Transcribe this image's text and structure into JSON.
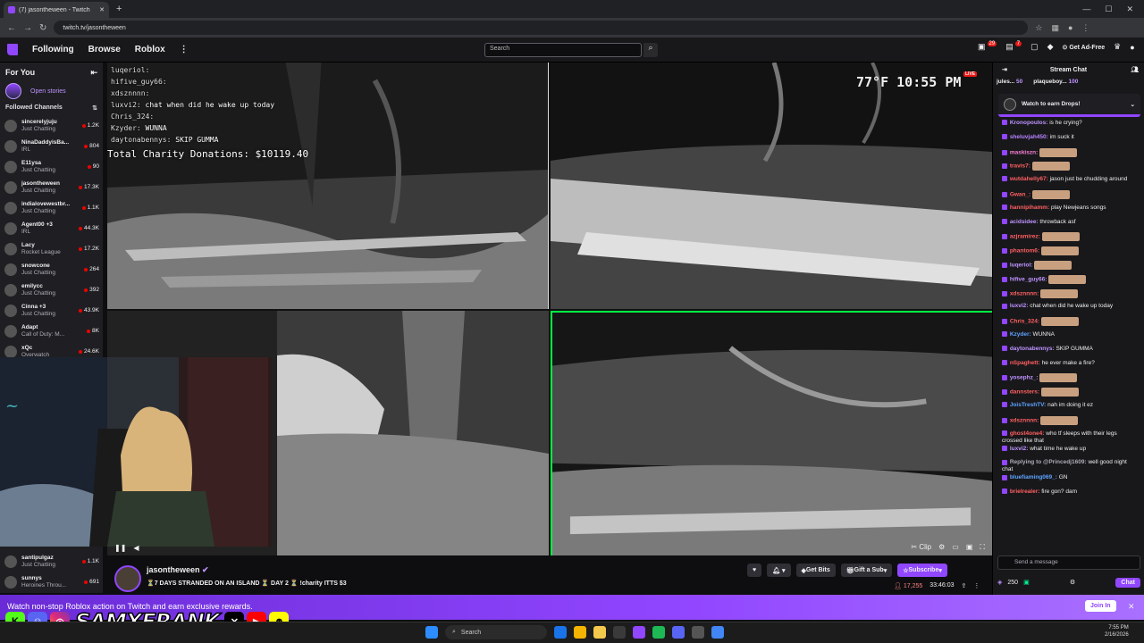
{
  "browser": {
    "tab_title": "(7) jasontheween - Twitch",
    "new_tab": "+",
    "url": "twitch.tv/jasontheween"
  },
  "topnav": {
    "following": "Following",
    "browse": "Browse",
    "roblox": "Roblox",
    "more": "⋮",
    "search_placeholder": "Search",
    "notif_count_1": "29",
    "notif_count_2": "7",
    "get_ad_free": "Get Ad-Free"
  },
  "sidebar": {
    "for_you": "For You",
    "open_stories": "Open stories",
    "followed_channels": "Followed Channels",
    "channels": [
      {
        "name": "sincerelyjuju",
        "game": "Just Chatting",
        "viewers": "1.2K"
      },
      {
        "name": "NinaDaddyisBa...",
        "game": "IRL",
        "viewers": "804"
      },
      {
        "name": "E11ysa",
        "game": "Just Chatting",
        "viewers": "90"
      },
      {
        "name": "jasontheween",
        "game": "Just Chatting",
        "viewers": "17.3K"
      },
      {
        "name": "indialovewestbr...",
        "game": "Just Chatting",
        "viewers": "1.1K"
      },
      {
        "name": "Agent00 +3",
        "game": "IRL",
        "viewers": "44.3K"
      },
      {
        "name": "Lacy",
        "game": "Rocket League",
        "viewers": "17.2K"
      },
      {
        "name": "snowcone",
        "game": "Just Chatting",
        "viewers": "264"
      },
      {
        "name": "emilycc",
        "game": "Just Chatting",
        "viewers": "392"
      },
      {
        "name": "Cinna +3",
        "game": "Just Chatting",
        "viewers": "43.9K"
      },
      {
        "name": "Adapt",
        "game": "Call of Duty: M...",
        "viewers": "8K"
      },
      {
        "name": "xQc",
        "game": "Overwatch",
        "viewers": "24.6K"
      }
    ],
    "lower_channels": [
      {
        "name": "santipulgaz",
        "game": "Just Chatting",
        "viewers": "1.1K"
      },
      {
        "name": "sunnys",
        "game": "Heroines Throu...",
        "viewers": "691"
      }
    ]
  },
  "video": {
    "overlay_chat": [
      {
        "user": "luqeriol:",
        "text": ""
      },
      {
        "user": "hifive_guy66:",
        "text": ""
      },
      {
        "user": "xdsznnnn:",
        "text": ""
      },
      {
        "user": "luxvi2:",
        "text": "chat when did he wake up today"
      },
      {
        "user": "Chris_324:",
        "text": ""
      },
      {
        "user": "Kzyder:",
        "text": "WUNNA"
      },
      {
        "user": "daytonabennys:",
        "text": "SKIP GUMMA"
      }
    ],
    "donations": "Total Charity Donations: $10119.40",
    "weather": "77°F 10:55 PM",
    "live": "LIVE",
    "clip": "Clip"
  },
  "stream": {
    "streamer": "jasontheween",
    "title": "⏳7 DAYS STRANDED ON AN ISLAND ⏳ DAY 2 ⏳ !charity ITTS $3",
    "get_bits": "Get Bits",
    "gift_sub": "Gift a Sub",
    "subscribe": "Subscribe",
    "viewers": "17,255",
    "uptime": "33:46:03"
  },
  "chat": {
    "header": "Stream Chat",
    "pinned": [
      {
        "user": "jules...",
        "amount": "50"
      },
      {
        "user": "plaqueboy...",
        "amount": "100"
      }
    ],
    "drops": "Watch to earn Drops!",
    "messages": [
      {
        "user": "Kronopoulos:",
        "text": "is he crying?",
        "color": "#bf94ff",
        "emote": false
      },
      {
        "user": "sheluvjah450:",
        "text": "im suck it",
        "color": "#b983ff",
        "emote": false
      },
      {
        "user": "maskiszn:",
        "text": "",
        "color": "#ff7fd8",
        "emote": true
      },
      {
        "user": "travis7:",
        "text": "",
        "color": "#ff6060",
        "emote": true
      },
      {
        "user": "wutdahelly67:",
        "text": "jason just be chudding around",
        "color": "#ff6060",
        "emote": false
      },
      {
        "user": "Gwan_:",
        "text": "",
        "color": "#ff6060",
        "emote": true
      },
      {
        "user": "hannipihamm:",
        "text": "play Newjeans songs",
        "color": "#ff6060",
        "emote": false
      },
      {
        "user": "acidsidee:",
        "text": "throwback asf",
        "color": "#bf94ff",
        "emote": false
      },
      {
        "user": "azjramirez:",
        "text": "",
        "color": "#ff6060",
        "emote": true
      },
      {
        "user": "phantom6:",
        "text": "",
        "color": "#ff6060",
        "emote": true
      },
      {
        "user": "luqeriol:",
        "text": "",
        "color": "#bf94ff",
        "emote": true
      },
      {
        "user": "hifive_guy66:",
        "text": "",
        "color": "#bf94ff",
        "emote": true
      },
      {
        "user": "xdsznnnn:",
        "text": "",
        "color": "#ff6060",
        "emote": true
      },
      {
        "user": "luxvi2:",
        "text": "chat when did he wake up today",
        "color": "#bf94ff",
        "emote": false
      },
      {
        "user": "Chris_324:",
        "text": "",
        "color": "#ff6060",
        "emote": true
      },
      {
        "user": "Kzyder:",
        "text": "WUNNA",
        "color": "#5ea3ff",
        "emote": false
      },
      {
        "user": "daytonabennys:",
        "text": "SKIP GUMMA",
        "color": "#bf94ff",
        "emote": false
      },
      {
        "user": "nSpaghett:",
        "text": "he ever make a fire?",
        "color": "#ff6060",
        "emote": false
      },
      {
        "user": "yosephz_:",
        "text": "",
        "color": "#bf94ff",
        "emote": true
      },
      {
        "user": "dannsters:",
        "text": "",
        "color": "#ff6060",
        "emote": true
      },
      {
        "user": "JoisTreshTV:",
        "text": "nah im doing it ez",
        "color": "#5ea3ff",
        "emote": false
      },
      {
        "user": "xdsznnnn:",
        "text": "",
        "color": "#ff6060",
        "emote": true
      },
      {
        "user": "ghost4one4:",
        "text": "who tf sleeps with their legs crossed like that",
        "color": "#ff6060",
        "emote": false
      },
      {
        "user": "luxvi2:",
        "text": "what time he wake up",
        "color": "#bf94ff",
        "emote": false
      },
      {
        "user": "Replying to @Princedj1609:",
        "text": "well good night chat",
        "color": "#adadb8",
        "emote": false
      },
      {
        "user": "bluefiaming069_:",
        "text": "GN",
        "color": "#5ea3ff",
        "emote": false
      },
      {
        "user": "brielrealer:",
        "text": "fire gon? dam",
        "color": "#ff6060",
        "emote": false
      }
    ],
    "input_placeholder": "Send a message",
    "points": "250",
    "chat_button": "Chat"
  },
  "banner": {
    "text": "Watch non-stop Roblox action on Twitch and earn exclusive rewards.",
    "join": "Join In",
    "close": "✕",
    "brand": "SAMXFRANK"
  },
  "taskbar": {
    "search": "Search",
    "time": "7:55 PM",
    "date": "2/16/2026"
  }
}
